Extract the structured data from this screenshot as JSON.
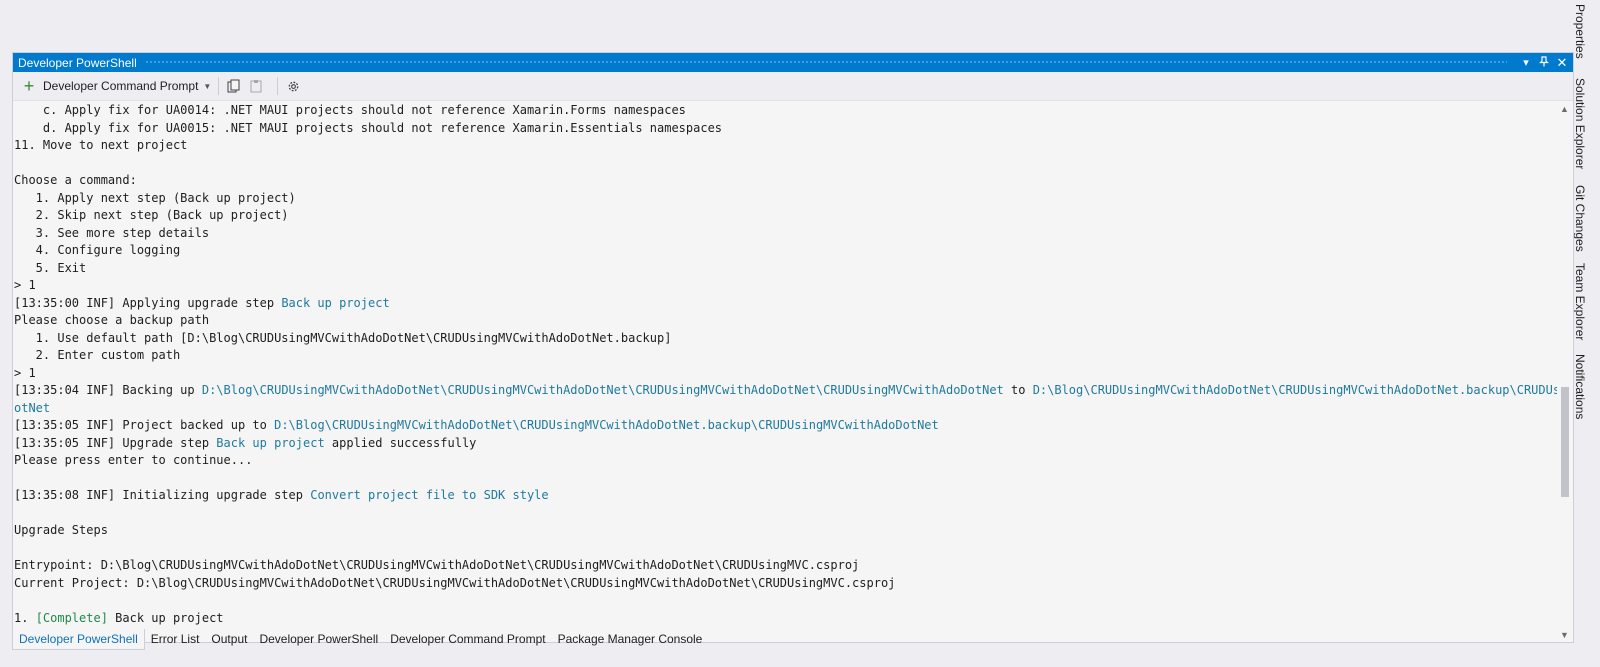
{
  "window": {
    "title": "Developer PowerShell"
  },
  "toolbar": {
    "new_terminal_label": "Developer Command Prompt",
    "icons": [
      "plus-icon",
      "chevron-down-icon",
      "copy-icon",
      "paste-icon",
      "gear-icon"
    ]
  },
  "title_bar_icons": [
    "dropdown-icon",
    "pin-icon",
    "close-icon"
  ],
  "right_panel_tabs": [
    "Properties",
    "Solution Explorer",
    "Git Changes",
    "Team Explorer",
    "Notifications"
  ],
  "terminal": {
    "lines": [
      [
        {
          "t": "    c. Apply fix for UA0014: .NET MAUI projects should not reference Xamarin.Forms namespaces"
        }
      ],
      [
        {
          "t": "    d. Apply fix for UA0015: .NET MAUI projects should not reference Xamarin.Essentials namespaces"
        }
      ],
      [
        {
          "t": "11. Move to next project"
        }
      ],
      [
        {
          "t": ""
        }
      ],
      [
        {
          "t": "Choose a command:"
        }
      ],
      [
        {
          "t": "   1. Apply next step (Back up project)"
        }
      ],
      [
        {
          "t": "   2. Skip next step (Back up project)"
        }
      ],
      [
        {
          "t": "   3. See more step details"
        }
      ],
      [
        {
          "t": "   4. Configure logging"
        }
      ],
      [
        {
          "t": "   5. Exit"
        }
      ],
      [
        {
          "t": "> 1"
        }
      ],
      [
        {
          "t": "[13:35:00 INF] Applying upgrade step "
        },
        {
          "t": "Back up project",
          "c": "hl"
        }
      ],
      [
        {
          "t": "Please choose a backup path"
        }
      ],
      [
        {
          "t": "   1. Use default path [D:\\Blog\\CRUDUsingMVCwithAdoDotNet\\CRUDUsingMVCwithAdoDotNet.backup]"
        }
      ],
      [
        {
          "t": "   2. Enter custom path"
        }
      ],
      [
        {
          "t": "> 1"
        }
      ],
      [
        {
          "t": "[13:35:04 INF] Backing up "
        },
        {
          "t": "D:\\Blog\\CRUDUsingMVCwithAdoDotNet\\CRUDUsingMVCwithAdoDotNet\\CRUDUsingMVCwithAdoDotNet\\CRUDUsingMVCwithAdoDotNet",
          "c": "hl"
        },
        {
          "t": " to "
        },
        {
          "t": "D:\\Blog\\CRUDUsingMVCwithAdoDotNet\\CRUDUsingMVCwithAdoDotNet.backup\\CRUDUsingMVCwithAdoD",
          "c": "hl"
        }
      ],
      [
        {
          "t": "otNet",
          "c": "hl"
        }
      ],
      [
        {
          "t": "[13:35:05 INF] Project backed up to "
        },
        {
          "t": "D:\\Blog\\CRUDUsingMVCwithAdoDotNet\\CRUDUsingMVCwithAdoDotNet.backup\\CRUDUsingMVCwithAdoDotNet",
          "c": "hl"
        }
      ],
      [
        {
          "t": "[13:35:05 INF] Upgrade step "
        },
        {
          "t": "Back up project",
          "c": "hl"
        },
        {
          "t": " applied successfully"
        }
      ],
      [
        {
          "t": "Please press enter to continue..."
        }
      ],
      [
        {
          "t": ""
        }
      ],
      [
        {
          "t": "[13:35:08 INF] Initializing upgrade step "
        },
        {
          "t": "Convert project file to SDK style",
          "c": "hl"
        }
      ],
      [
        {
          "t": ""
        }
      ],
      [
        {
          "t": "Upgrade Steps"
        }
      ],
      [
        {
          "t": ""
        }
      ],
      [
        {
          "t": "Entrypoint: D:\\Blog\\CRUDUsingMVCwithAdoDotNet\\CRUDUsingMVCwithAdoDotNet\\CRUDUsingMVCwithAdoDotNet\\CRUDUsingMVC.csproj"
        }
      ],
      [
        {
          "t": "Current Project: D:\\Blog\\CRUDUsingMVCwithAdoDotNet\\CRUDUsingMVCwithAdoDotNet\\CRUDUsingMVCwithAdoDotNet\\CRUDUsingMVC.csproj"
        }
      ],
      [
        {
          "t": ""
        }
      ],
      [
        {
          "t": "1. "
        },
        {
          "t": "[Complete]",
          "c": "ok"
        },
        {
          "t": " Back up project"
        }
      ]
    ]
  },
  "bottom_tabs": [
    "Developer PowerShell",
    "Error List",
    "Output",
    "Developer PowerShell",
    "Developer Command Prompt",
    "Package Manager Console"
  ],
  "colors": {
    "accent": "#007acc",
    "link_text": "#1f7a9e",
    "success_text": "#1e8a4a",
    "active_tab_text": "#0e70c0"
  }
}
